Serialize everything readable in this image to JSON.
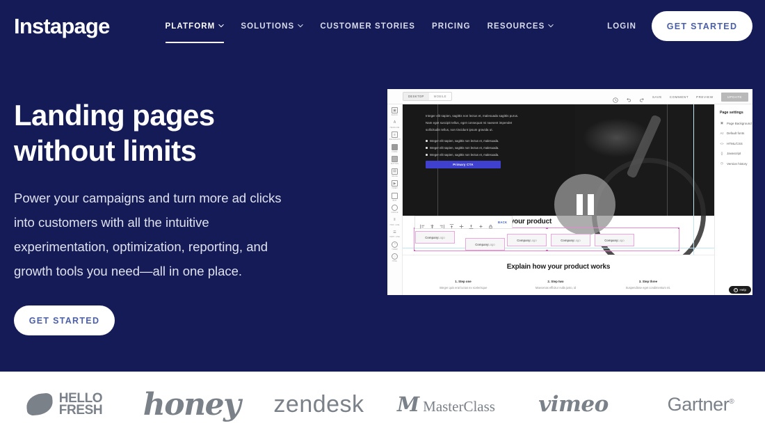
{
  "brand": {
    "logo_text": "Instapage",
    "bg_color": "#141b57",
    "accent_text": "#4b5fa8"
  },
  "nav": {
    "items": [
      {
        "label": "PLATFORM",
        "has_caret": true,
        "active": true,
        "icon": "chevron-down-icon"
      },
      {
        "label": "SOLUTIONS",
        "has_caret": true,
        "active": false,
        "icon": "chevron-down-icon"
      },
      {
        "label": "CUSTOMER STORIES",
        "has_caret": false,
        "active": false,
        "icon": ""
      },
      {
        "label": "PRICING",
        "has_caret": false,
        "active": false,
        "icon": ""
      },
      {
        "label": "RESOURCES",
        "has_caret": true,
        "active": false,
        "icon": "chevron-down-icon"
      }
    ],
    "login_label": "LOGIN",
    "cta_label": "GET STARTED"
  },
  "hero": {
    "title": "Landing pages without limits",
    "subtitle": "Power your campaigns and turn more ad clicks into customers with all the intuitive experimentation, optimization, reporting, and growth tools you need—all in one place.",
    "cta_label": "GET STARTED"
  },
  "mockup": {
    "device_tabs": [
      {
        "label": "DESKTOP",
        "selected": true
      },
      {
        "label": "MOBILE",
        "selected": false
      }
    ],
    "toolbar": {
      "icons": [
        "history-icon",
        "undo-icon",
        "redo-icon"
      ],
      "actions": [
        "SAVE",
        "COMMENT",
        "PREVIEW"
      ],
      "primary_action": "UPDATE"
    },
    "rail_items": [
      {
        "label": "BLOCK",
        "icon": "block-icon"
      },
      {
        "label": "HEADLINE",
        "icon": "headline-icon"
      },
      {
        "label": "PARAGRAPH",
        "icon": "paragraph-icon"
      },
      {
        "label": "FORM",
        "icon": "form-icon"
      },
      {
        "label": "BUTTON",
        "icon": "button-icon"
      },
      {
        "label": "IMAGE",
        "icon": "image-icon"
      },
      {
        "label": "VIDEO",
        "icon": "video-icon"
      },
      {
        "label": "BOX",
        "icon": "box-icon"
      },
      {
        "label": "CIRCLE",
        "icon": "circle-icon"
      },
      {
        "label": "HOR. LINE",
        "icon": "horizontal-line-icon"
      },
      {
        "label": "VERT. LINE",
        "icon": "vertical-line-icon"
      },
      {
        "label": "TIMER",
        "icon": "timer-icon"
      },
      {
        "label": "HTML",
        "icon": "html-icon"
      }
    ],
    "canvas": {
      "paragraph": [
        "Integer elit sapien, sagittis non lectus et, malesuada sagittis purus.",
        "Nam eget suscipit tellus, eget consequat mi naesent impendet",
        "sollicitudin tellus, non tincidunt ipsum gravida ut."
      ],
      "bullets": [
        "Integer elit sapien, sagittis non lectus et, malesuada.",
        "Integer elit sapien, sagittis non lectus et, malesuada.",
        "Integer elit sapien, sagittis non lectus et, malesuada."
      ],
      "cta_label": "Primary CTA",
      "player_state": "pause",
      "floatbar_back_label": "BACK",
      "section_heading": "Customers love your product",
      "logo_placeholders": [
        {
          "strong": "Company",
          "light": "Logo"
        },
        {
          "strong": "Company",
          "light": "Logo"
        },
        {
          "strong": "Company",
          "light": "Logo"
        },
        {
          "strong": "Company",
          "light": "Logo"
        },
        {
          "strong": "Company",
          "light": "Logo"
        }
      ],
      "steps_heading": "Explain how your product works",
      "steps": [
        {
          "title": "1. Step one",
          "desc": "Integer quis erat luctus ex scelerisque"
        },
        {
          "title": "2. Step two",
          "desc": "Maecenas efficitur nulla justo, id"
        },
        {
          "title": "3. Step three",
          "desc": "Suspendisse eget condimentum mi."
        }
      ]
    },
    "panel": {
      "title": "Page settings",
      "rows": [
        {
          "label": "Page Background",
          "icon": "image-icon"
        },
        {
          "label": "Default fonts",
          "icon": "font-icon"
        },
        {
          "label": "HTML/CSS",
          "icon": "code-icon"
        },
        {
          "label": "Javascript",
          "icon": "braces-icon"
        },
        {
          "label": "Version history",
          "icon": "clock-icon"
        }
      ]
    },
    "help_label": "Help"
  },
  "logo_strip": {
    "logos": [
      {
        "name": "HelloFresh",
        "line1": "HELLO",
        "line2": "FRESH"
      },
      {
        "name": "honey",
        "text": "honey"
      },
      {
        "name": "zendesk",
        "text": "zendesk"
      },
      {
        "name": "MasterClass",
        "mark": "M",
        "text": "MasterClass"
      },
      {
        "name": "vimeo",
        "text": "vimeo"
      },
      {
        "name": "Gartner",
        "text": "Gartner",
        "mark": "®"
      }
    ]
  }
}
